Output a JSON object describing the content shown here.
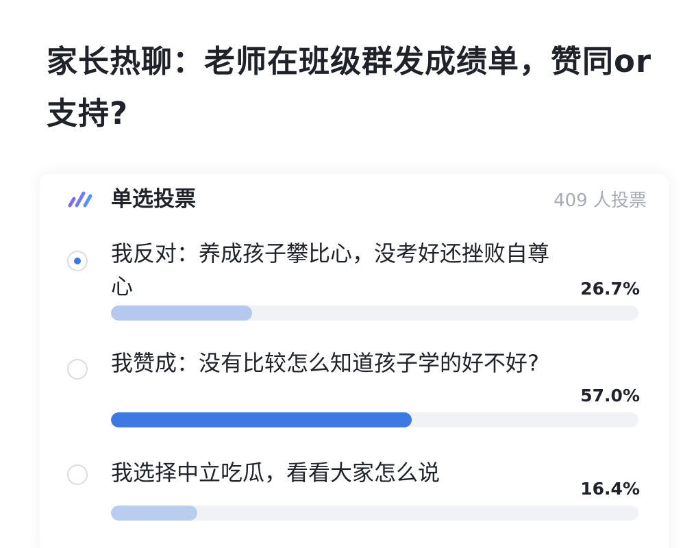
{
  "post": {
    "title": "家长热聊：老师在班级群发成绩单，赞同or支持?"
  },
  "poll": {
    "type_label": "单选投票",
    "vote_count": "409 人投票",
    "icon": "poll-icon",
    "colors": {
      "accent": "#3e76e8",
      "fill_selected": "#b4c9ee",
      "fill_default": "#b9cdef",
      "fill_leading": "#3d78e3",
      "track": "#f1f2f5"
    },
    "options": [
      {
        "text": "我反对：养成孩子攀比心，没考好还挫败自尊心",
        "percent_label": "26.7%",
        "fraction": 0.267,
        "selected": true
      },
      {
        "text": "我赞成：没有比较怎么知道孩子学的好不好?",
        "percent_label": "57.0%",
        "fraction": 0.57,
        "selected": false
      },
      {
        "text": "我选择中立吃瓜，看看大家怎么说",
        "percent_label": "16.4%",
        "fraction": 0.164,
        "selected": false
      }
    ]
  }
}
